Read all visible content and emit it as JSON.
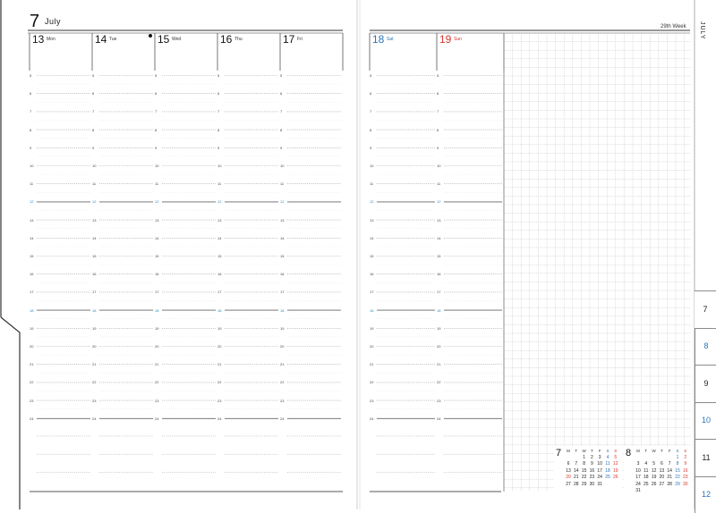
{
  "header": {
    "month_number": "7",
    "month_name": "July",
    "week_label": "29th Week"
  },
  "side_label": "JULY",
  "days": [
    {
      "num": "13",
      "name": "Mon",
      "kind": "weekday",
      "holiday": false
    },
    {
      "num": "14",
      "name": "Tue",
      "kind": "weekday",
      "holiday": true
    },
    {
      "num": "15",
      "name": "Wed",
      "kind": "weekday",
      "holiday": false
    },
    {
      "num": "16",
      "name": "Thu",
      "kind": "weekday",
      "holiday": false
    },
    {
      "num": "17",
      "name": "Fri",
      "kind": "weekday",
      "holiday": false
    },
    {
      "num": "18",
      "name": "Sat",
      "kind": "sat",
      "holiday": false
    },
    {
      "num": "19",
      "name": "Sun",
      "kind": "sun",
      "holiday": false
    }
  ],
  "hours": [
    "5",
    "6",
    "7",
    "8",
    "9",
    "10",
    "11",
    "12",
    "13",
    "14",
    "15",
    "16",
    "17",
    "18",
    "19",
    "20",
    "21",
    "22",
    "23",
    "24"
  ],
  "highlight_hours": [
    "12",
    "18"
  ],
  "tabs": [
    {
      "label": "7",
      "active": true
    },
    {
      "label": "8",
      "active": false
    },
    {
      "label": "9",
      "active": false
    },
    {
      "label": "10",
      "active": false
    },
    {
      "label": "11",
      "active": false
    },
    {
      "label": "12",
      "active": false
    }
  ],
  "colors": {
    "line": "#555555",
    "dotted": "#9a9a9a",
    "grid": "#b5b5b5",
    "blue": "#2a74b8",
    "red": "#d9372f",
    "teal": "#2a8cc0"
  },
  "mini_calendars": [
    {
      "month": "7",
      "weekday_headers": [
        "M",
        "T",
        "W",
        "T",
        "F",
        "S",
        "S"
      ],
      "weeks": [
        [
          "",
          "",
          "1",
          "2",
          "3",
          "4",
          "5"
        ],
        [
          "6",
          "7",
          "8",
          "9",
          "10",
          "11",
          "12"
        ],
        [
          "13",
          "14",
          "15",
          "16",
          "17",
          "18",
          "19"
        ],
        [
          "20",
          "21",
          "22",
          "23",
          "24",
          "25",
          "26"
        ],
        [
          "27",
          "28",
          "29",
          "30",
          "31",
          "",
          ""
        ]
      ]
    },
    {
      "month": "8",
      "weekday_headers": [
        "M",
        "T",
        "W",
        "T",
        "F",
        "S",
        "S"
      ],
      "weeks": [
        [
          "",
          "",
          "",
          "",
          "",
          "1",
          "2"
        ],
        [
          "3",
          "4",
          "5",
          "6",
          "7",
          "8",
          "9"
        ],
        [
          "10",
          "11",
          "12",
          "13",
          "14",
          "15",
          "16"
        ],
        [
          "17",
          "18",
          "19",
          "20",
          "21",
          "22",
          "23"
        ],
        [
          "24",
          "25",
          "26",
          "27",
          "28",
          "29",
          "30"
        ],
        [
          "31",
          "",
          "",
          "",
          "",
          "",
          ""
        ]
      ]
    }
  ]
}
